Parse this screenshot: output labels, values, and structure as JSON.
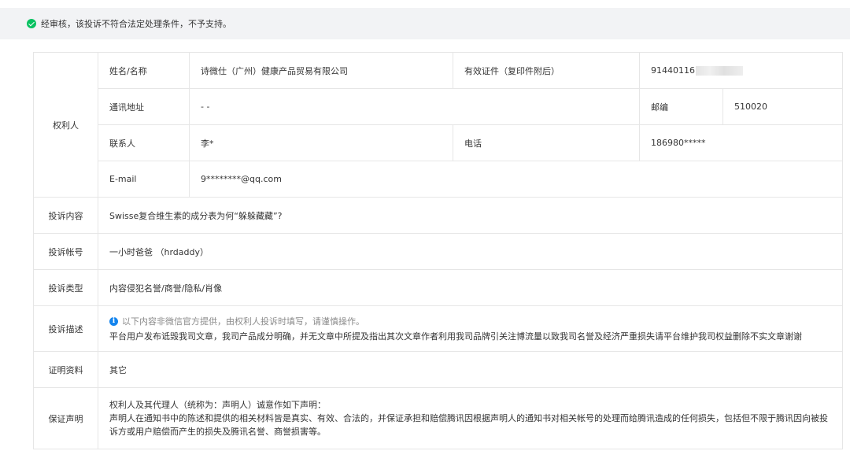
{
  "notice": {
    "text": "经审核，该投诉不符合法定处理条件，不予支持。"
  },
  "rights_holder": {
    "section_label": "权利人",
    "name_label": "姓名/名称",
    "name_value": "诗微仕（广州）健康产品贸易有限公司",
    "cert_label": "有效证件（复印件附后）",
    "cert_value": "91440116",
    "address_label": "通讯地址",
    "address_value": "- -",
    "postcode_label": "邮编",
    "postcode_value": "510020",
    "contact_label": "联系人",
    "contact_value": "李*",
    "phone_label": "电话",
    "phone_value": "186980*****",
    "email_label": "E-mail",
    "email_value": "9********@qq.com"
  },
  "complaint": {
    "content_label": "投诉内容",
    "content_value": "Swisse复合维生素的成分表为何“躲躲藏藏”?",
    "account_label": "投诉帐号",
    "account_value": "一小时爸爸 （hrdaddy）",
    "type_label": "投诉类型",
    "type_value": "内容侵犯名誉/商誉/隐私/肖像",
    "desc_label": "投诉描述",
    "desc_tip": "以下内容非微信官方提供，由权利人投诉时填写，请谨慎操作。",
    "desc_value": "平台用户发布诋毁我司文章，我司产品成分明确，并无文章中所提及指出其次文章作者利用我司品牌引关注博流量以致我司名誉及经济严重损失请平台维护我司权益删除不实文章谢谢",
    "evidence_label": "证明资料",
    "evidence_value": "其它",
    "statement_label": "保证声明",
    "statement_line1": "权利人及其代理人（统称为：声明人）诚意作如下声明：",
    "statement_line2": "声明人在通知书中的陈述和提供的相关材料皆是真实、有效、合法的，并保证承担和赔偿腾讯因根据声明人的通知书对相关帐号的处理而给腾讯造成的任何损失，包括但不限于腾讯因向被投诉方或用户赔偿而产生的损失及腾讯名誉、商誉损害等。"
  }
}
